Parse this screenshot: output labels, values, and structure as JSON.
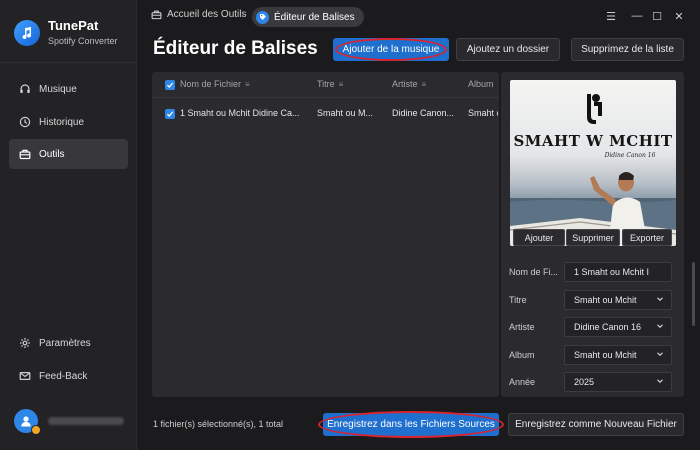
{
  "app": {
    "name": "TunePat",
    "subtitle": "Spotify Converter"
  },
  "sidebar": {
    "items": [
      {
        "label": "Musique",
        "icon": "headphones-icon"
      },
      {
        "label": "Historique",
        "icon": "clock-icon"
      },
      {
        "label": "Outils",
        "icon": "toolbox-icon",
        "active": true
      }
    ],
    "bottom_items": [
      {
        "label": "Paramètres",
        "icon": "gear-icon"
      },
      {
        "label": "Feed-Back",
        "icon": "mail-icon"
      }
    ]
  },
  "breadcrumb": {
    "home": "Accueil des Outils",
    "separator": "›",
    "current": "Éditeur de Balises"
  },
  "window": {
    "menu": "☰",
    "minimize": "—",
    "maximize": "☐",
    "close": "✕"
  },
  "page": {
    "title": "Éditeur de Balises"
  },
  "toolbar": {
    "add_music": "Ajouter de la musique",
    "add_folder": "Ajoutez un dossier",
    "clear_list": "Supprimez de la liste"
  },
  "table": {
    "columns": [
      "Nom de Fichier",
      "Titre",
      "Artiste",
      "Album"
    ],
    "rows": [
      {
        "checked": true,
        "file": "1 Smaht ou Mchit Didine Ca...",
        "title": "Smaht ou M...",
        "artist": "Didine Canon...",
        "album": "Smaht o"
      }
    ]
  },
  "cover": {
    "artist_text": "Didine Canon 16",
    "title_text": "SMAHT W MCHIT",
    "buttons": {
      "add": "Ajouter",
      "remove": "Supprimer",
      "export": "Exporter"
    }
  },
  "fields": [
    {
      "label": "Nom de Fi...",
      "value": "1 Smaht ou Mchit I",
      "dropdown": false
    },
    {
      "label": "Titre",
      "value": "Smaht ou Mchit",
      "dropdown": true
    },
    {
      "label": "Artiste",
      "value": "Didine Canon 16",
      "dropdown": true
    },
    {
      "label": "Album",
      "value": "Smaht ou Mchit",
      "dropdown": true
    },
    {
      "label": "Année",
      "value": "2025",
      "dropdown": true
    }
  ],
  "footer": {
    "status": "1 fichier(s) sélectionné(s), 1 total",
    "save_sources": "Enregistrez dans les Fichiers Sources",
    "save_new": "Enregistrez comme Nouveau Fichier"
  },
  "colors": {
    "accent": "#1f6fce",
    "highlight_oval": "#d9232e",
    "background": "#1b1b1d"
  }
}
